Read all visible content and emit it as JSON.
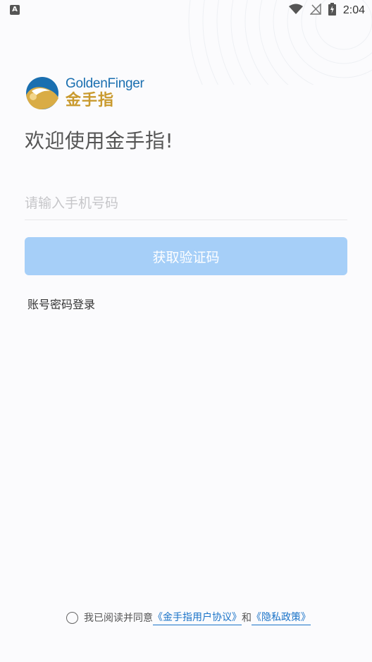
{
  "status_bar": {
    "notification_icon": "A",
    "time": "2:04",
    "icons": [
      "wifi-icon",
      "no-signal-icon",
      "battery-charging-icon"
    ]
  },
  "logo": {
    "en_prefix": "Golden",
    "en_suffix": "Finger",
    "cn": "金手指"
  },
  "welcome": "欢迎使用金手指!",
  "phone": {
    "placeholder": "请输入手机号码",
    "value": ""
  },
  "get_code_button": "获取验证码",
  "password_login": "账号密码登录",
  "agreement": {
    "prefix": "我已阅读并同意",
    "user_agreement": "《金手指用户协议》",
    "joiner": "和",
    "privacy_policy": "《隐私政策》",
    "checked": false
  },
  "colors": {
    "button": "#a6cff8",
    "link": "#1a73c8",
    "brand_blue": "#1a6fb0",
    "brand_gold": "#c99a2e"
  }
}
